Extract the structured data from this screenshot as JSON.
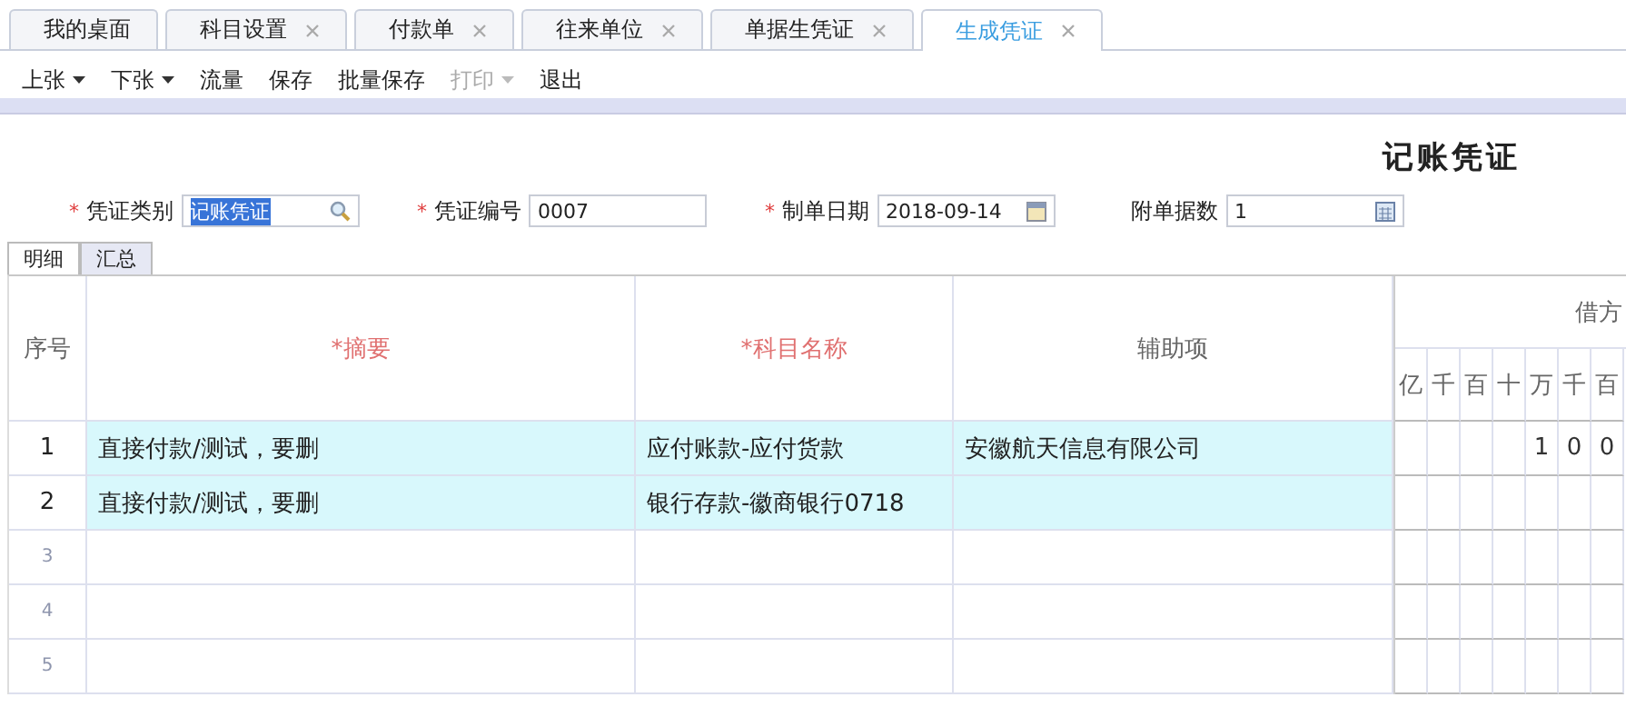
{
  "tabs": [
    {
      "label": "我的桌面",
      "selected": false,
      "closable": false
    },
    {
      "label": "科目设置",
      "selected": false,
      "closable": true
    },
    {
      "label": "付款单",
      "selected": false,
      "closable": true
    },
    {
      "label": "往来单位",
      "selected": false,
      "closable": true
    },
    {
      "label": "单据生凭证",
      "selected": false,
      "closable": true
    },
    {
      "label": "生成凭证",
      "selected": true,
      "closable": true
    }
  ],
  "toolbar": [
    {
      "label": "上张",
      "kind": "dropdown",
      "disabled": false
    },
    {
      "label": "下张",
      "kind": "dropdown",
      "disabled": false
    },
    {
      "label": "流量",
      "kind": "button",
      "disabled": false
    },
    {
      "label": "保存",
      "kind": "button",
      "disabled": false
    },
    {
      "label": "批量保存",
      "kind": "button",
      "disabled": false
    },
    {
      "label": "打印",
      "kind": "dropdown",
      "disabled": true
    },
    {
      "label": "退出",
      "kind": "button",
      "disabled": false
    }
  ],
  "voucher_title": "记账凭证",
  "required_mark": "*",
  "fields": [
    {
      "label": "凭证类别",
      "required": true,
      "value": "记账凭证",
      "highlighted": true,
      "kind": "search"
    },
    {
      "label": "凭证编号",
      "required": true,
      "value": "0007",
      "highlighted": false,
      "kind": "text"
    },
    {
      "label": "制单日期",
      "required": true,
      "value": "2018-09-14",
      "highlighted": false,
      "kind": "date"
    },
    {
      "label": "附单据数",
      "required": false,
      "value": "1",
      "highlighted": false,
      "kind": "calc"
    }
  ],
  "subtabs": [
    {
      "label": "明细",
      "selected": true
    },
    {
      "label": "汇总",
      "selected": false
    }
  ],
  "table": {
    "columns": [
      "序号",
      "*摘要",
      "*科目名称",
      "辅助项"
    ],
    "debit_header": "借方",
    "debit_units": [
      "亿",
      "千",
      "百",
      "十",
      "万",
      "千",
      "百"
    ],
    "rows": [
      {
        "index": "1",
        "summary": "直接付款/测试，要删",
        "subject": "应付账款-应付货款",
        "aux": "安徽航天信息有限公司",
        "digits": [
          "1",
          "0",
          "0"
        ]
      },
      {
        "index": "2",
        "summary": "直接付款/测试，要删",
        "subject": "银行存款-徽商银行0718"
      },
      {
        "index": "3"
      },
      {
        "index": "4"
      },
      {
        "index": "5"
      }
    ]
  }
}
